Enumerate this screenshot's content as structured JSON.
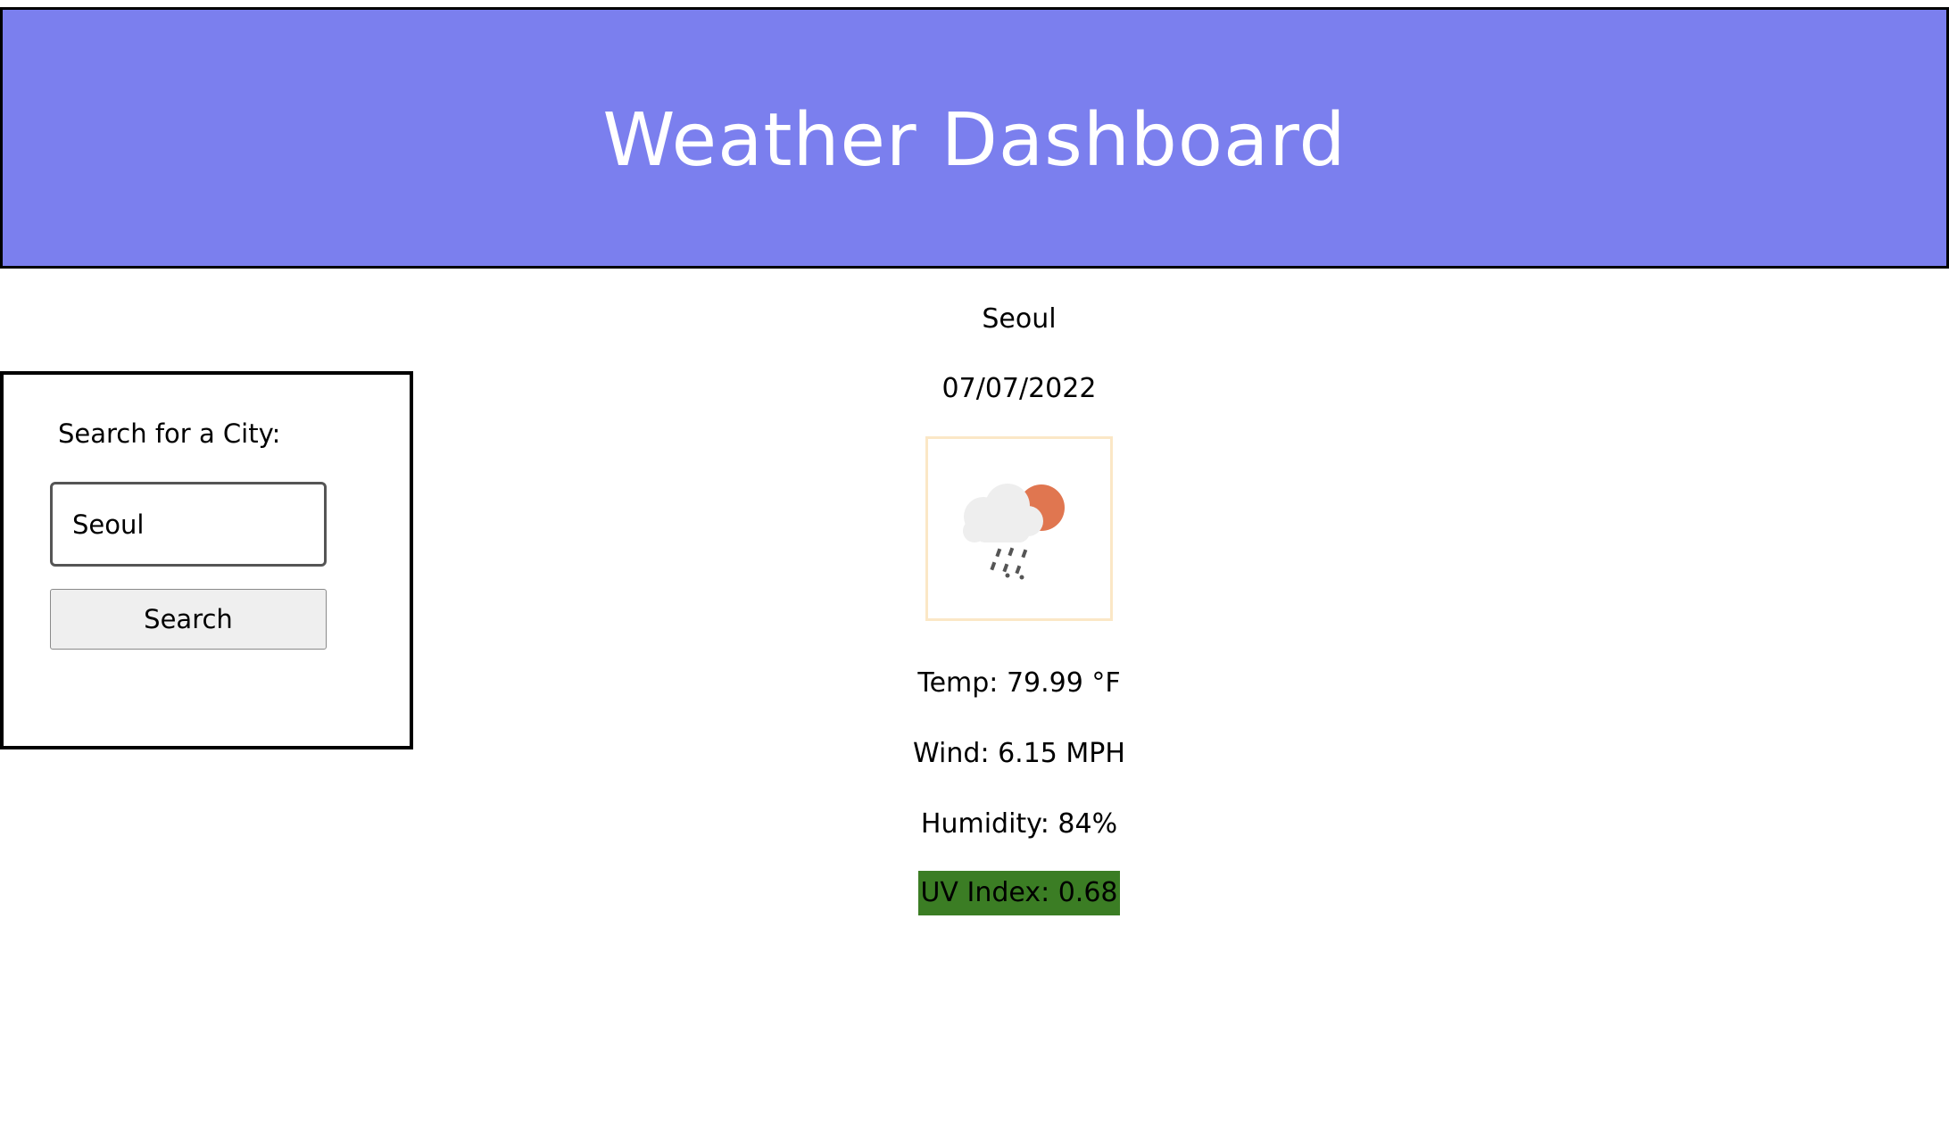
{
  "header": {
    "title": "Weather Dashboard",
    "background_color": "#7b7fee"
  },
  "search": {
    "label": "Search for a City:",
    "input_value": "Seoul",
    "button_label": "Search"
  },
  "current": {
    "city": "Seoul",
    "date": "07/07/2022",
    "icon": "rain-cloud-sun-icon",
    "temp": "Temp: 79.99 °F",
    "wind": "Wind: 6.15 MPH",
    "humidity": "Humidity: 84%",
    "uv": "UV Index: 0.68",
    "uv_color": "#3b7d24"
  }
}
